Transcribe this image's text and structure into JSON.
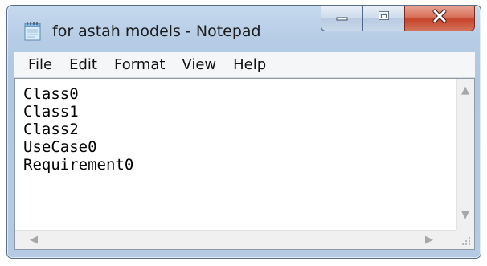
{
  "window": {
    "title": "for astah models - Notepad",
    "icon": "notepad-icon"
  },
  "caption_buttons": {
    "minimize": "minimize-icon",
    "maximize": "maximize-icon",
    "close": "close-icon"
  },
  "menu": {
    "items": [
      {
        "label": "File"
      },
      {
        "label": "Edit"
      },
      {
        "label": "Format"
      },
      {
        "label": "View"
      },
      {
        "label": "Help"
      }
    ]
  },
  "editor": {
    "lines": [
      "Class0",
      "Class1",
      "Class2",
      "UseCase0",
      "Requirement0"
    ]
  },
  "colors": {
    "frame": "#b7cde6",
    "close_button": "#c5442b",
    "editor_background": "#ffffff"
  }
}
